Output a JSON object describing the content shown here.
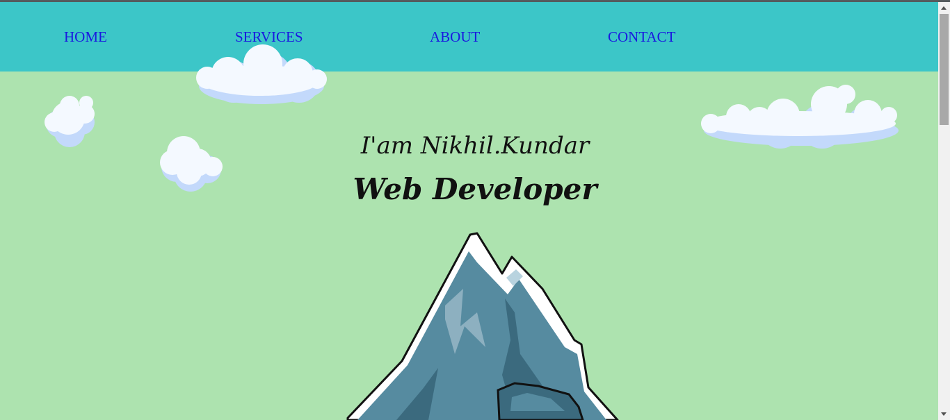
{
  "nav": {
    "items": [
      {
        "label": "HOME"
      },
      {
        "label": "SERVICES"
      },
      {
        "label": "ABOUT"
      },
      {
        "label": "CONTACT"
      }
    ]
  },
  "hero": {
    "greeting": "I'am Nikhil.Kundar",
    "role": "Web Developer"
  },
  "colors": {
    "nav_background": "#3cc6c8",
    "page_background": "#ade3af",
    "link": "#1a1adf"
  }
}
